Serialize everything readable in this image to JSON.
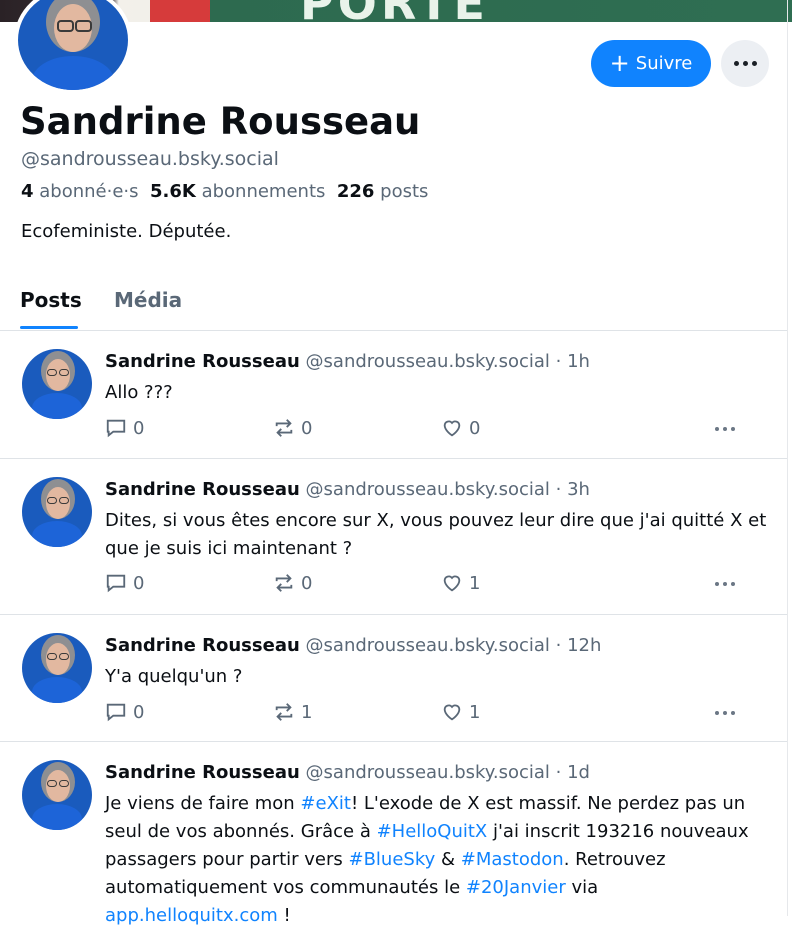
{
  "profile": {
    "name": "Sandrine Rousseau",
    "handle": "@sandrousseau.bsky.social",
    "followers_count": "4",
    "followers_label": "abonné·e·s",
    "following_count": "5.6K",
    "following_label": "abonnements",
    "posts_count": "226",
    "posts_label": "posts",
    "bio": "Ecofeministe. Députée.",
    "follow_label": "Suivre"
  },
  "tabs": [
    {
      "label": "Posts",
      "active": true
    },
    {
      "label": "Média",
      "active": false
    }
  ],
  "posts": [
    {
      "author": "Sandrine Rousseau",
      "handle": "@sandrousseau.bsky.social",
      "time": "· 1h",
      "text": "Allo ???",
      "replies": "0",
      "reposts": "0",
      "likes": "0"
    },
    {
      "author": "Sandrine Rousseau",
      "handle": "@sandrousseau.bsky.social",
      "time": "· 3h",
      "text": "Dites, si vous êtes encore sur X, vous pouvez leur dire que j'ai quitté X et que je suis ici maintenant ?",
      "replies": "0",
      "reposts": "0",
      "likes": "1"
    },
    {
      "author": "Sandrine Rousseau",
      "handle": "@sandrousseau.bsky.social",
      "time": "· 12h",
      "text": "Y'a quelqu'un ?",
      "replies": "0",
      "reposts": "1",
      "likes": "1"
    },
    {
      "author": "Sandrine Rousseau",
      "handle": "@sandrousseau.bsky.social",
      "time": "· 1d",
      "text_parts": {
        "p1": "Je viens de faire mon ",
        "tag1": "#eXit",
        "p2": "! L'exode de X est massif. Ne perdez pas un seul de vos abonnés. Grâce à ",
        "tag2": "#HelloQuitX",
        "p3": " j'ai inscrit 193216 nouveaux passagers pour partir vers ",
        "tag3": "#BlueSky",
        "p4": " & ",
        "tag4": "#Mastodon",
        "p5": ". Retrouvez automatiquement vos communautés le ",
        "tag5": "#20Janvier",
        "p6": " via",
        "link": "app.helloquitx.com",
        "p7": " !"
      }
    }
  ],
  "colors": {
    "accent": "#1083fe",
    "muted": "#5a6877",
    "text": "#0b0f14"
  },
  "icons": [
    "plus-icon",
    "more-dots-icon",
    "reply-icon",
    "repost-icon",
    "like-icon"
  ]
}
